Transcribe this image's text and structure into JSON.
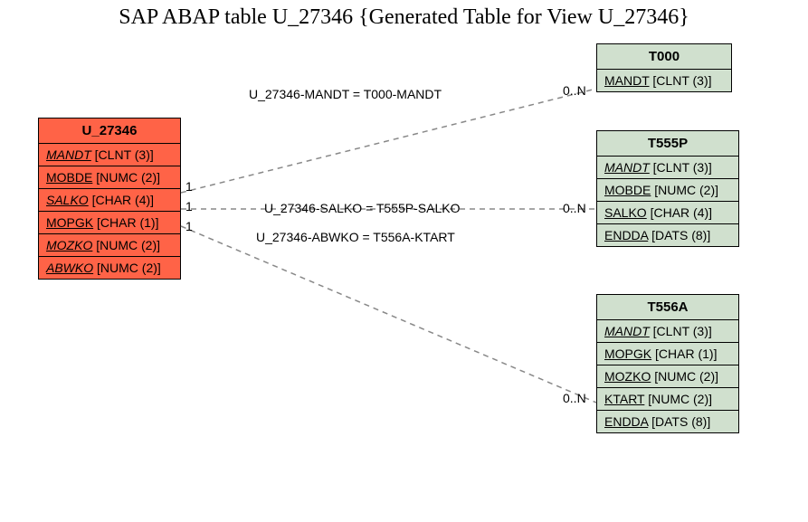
{
  "title": "SAP ABAP table U_27346 {Generated Table for View U_27346}",
  "colors": {
    "primary": "#ff6347",
    "secondary": "#d0e0ce"
  },
  "tables": {
    "main": {
      "name": "U_27346",
      "fields": [
        {
          "name": "MANDT",
          "type": "[CLNT (3)]",
          "fk": true
        },
        {
          "name": "MOBDE",
          "type": "[NUMC (2)]",
          "fk": false
        },
        {
          "name": "SALKO",
          "type": "[CHAR (4)]",
          "fk": true
        },
        {
          "name": "MOPGK",
          "type": "[CHAR (1)]",
          "fk": false
        },
        {
          "name": "MOZKO",
          "type": "[NUMC (2)]",
          "fk": true
        },
        {
          "name": "ABWKO",
          "type": "[NUMC (2)]",
          "fk": true
        }
      ]
    },
    "t000": {
      "name": "T000",
      "fields": [
        {
          "name": "MANDT",
          "type": "[CLNT (3)]",
          "fk": false
        }
      ]
    },
    "t555p": {
      "name": "T555P",
      "fields": [
        {
          "name": "MANDT",
          "type": "[CLNT (3)]",
          "fk": true
        },
        {
          "name": "MOBDE",
          "type": "[NUMC (2)]",
          "fk": false
        },
        {
          "name": "SALKO",
          "type": "[CHAR (4)]",
          "fk": false
        },
        {
          "name": "ENDDA",
          "type": "[DATS (8)]",
          "fk": false
        }
      ]
    },
    "t556a": {
      "name": "T556A",
      "fields": [
        {
          "name": "MANDT",
          "type": "[CLNT (3)]",
          "fk": true
        },
        {
          "name": "MOPGK",
          "type": "[CHAR (1)]",
          "fk": false
        },
        {
          "name": "MOZKO",
          "type": "[NUMC (2)]",
          "fk": false
        },
        {
          "name": "KTART",
          "type": "[NUMC (2)]",
          "fk": false
        },
        {
          "name": "ENDDA",
          "type": "[DATS (8)]",
          "fk": false
        }
      ]
    }
  },
  "relations": {
    "r1": {
      "label": "U_27346-MANDT = T000-MANDT",
      "left": "1",
      "right": "0..N"
    },
    "r2": {
      "label": "U_27346-SALKO = T555P-SALKO",
      "left": "1",
      "right": "0..N"
    },
    "r3": {
      "label": "U_27346-ABWKO = T556A-KTART",
      "left": "1",
      "right": "0..N"
    }
  }
}
